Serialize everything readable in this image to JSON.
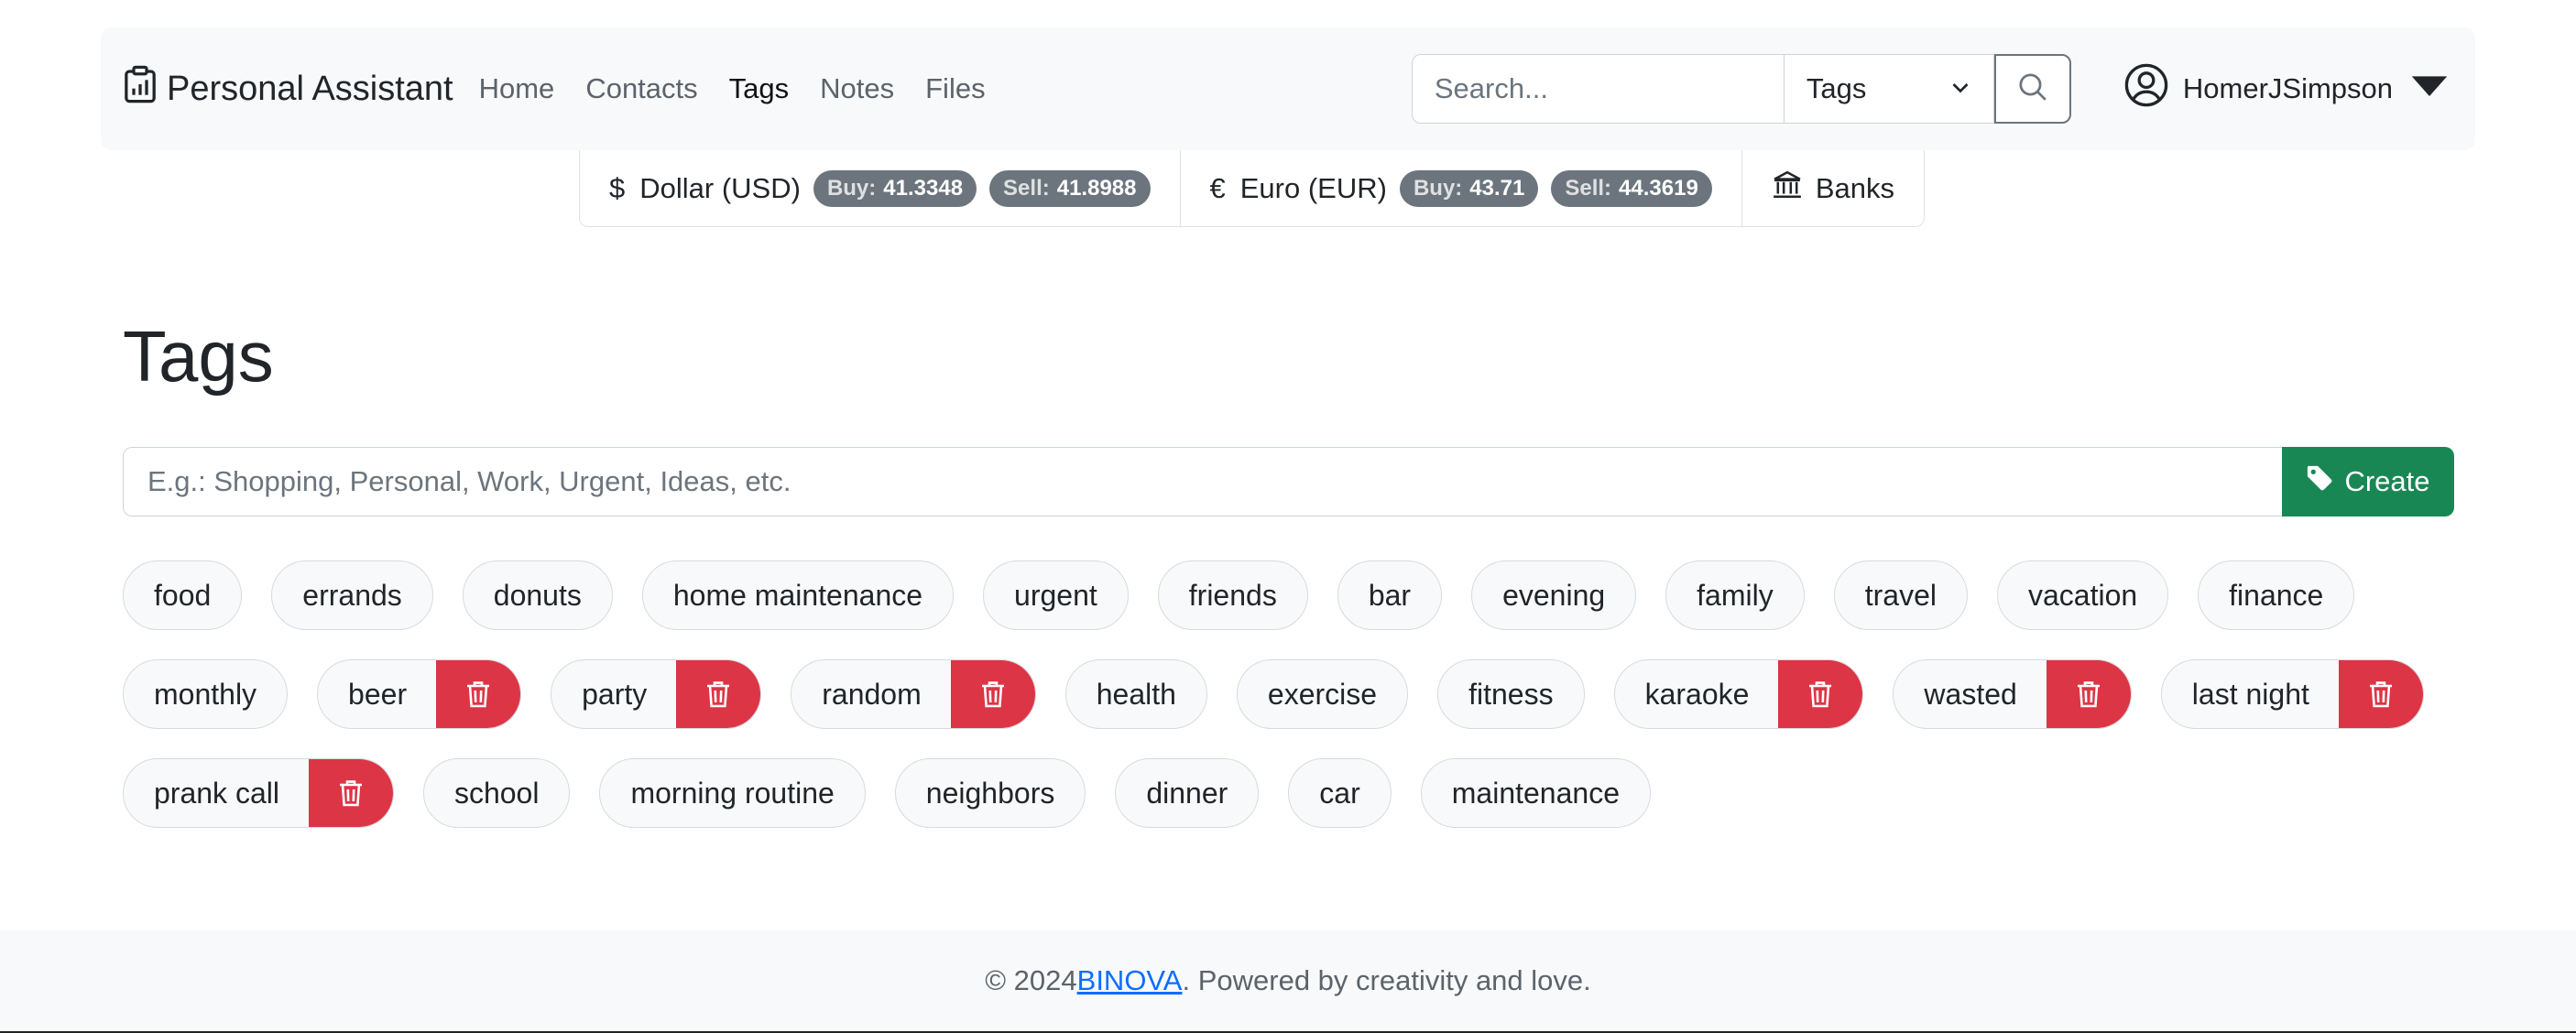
{
  "brand": {
    "name": "Personal Assistant"
  },
  "nav": {
    "links": [
      {
        "label": "Home",
        "active": false
      },
      {
        "label": "Contacts",
        "active": false
      },
      {
        "label": "Tags",
        "active": true
      },
      {
        "label": "Notes",
        "active": false
      },
      {
        "label": "Files",
        "active": false
      }
    ]
  },
  "search": {
    "placeholder": "Search...",
    "scope": "Tags"
  },
  "user": {
    "name": "HomerJSimpson"
  },
  "currency": {
    "usd": {
      "symbol": "$",
      "name": "Dollar (USD)",
      "buy_label": "Buy:",
      "buy": "41.3348",
      "sell_label": "Sell:",
      "sell": "41.8988"
    },
    "eur": {
      "symbol": "€",
      "name": "Euro (EUR)",
      "buy_label": "Buy:",
      "buy": "43.71",
      "sell_label": "Sell:",
      "sell": "44.3619"
    },
    "banks_label": "Banks"
  },
  "page": {
    "title": "Tags",
    "input_placeholder": "E.g.: Shopping, Personal, Work, Urgent, Ideas, etc.",
    "create_label": "Create"
  },
  "tags": [
    {
      "label": "food",
      "deletable": false
    },
    {
      "label": "errands",
      "deletable": false
    },
    {
      "label": "donuts",
      "deletable": false
    },
    {
      "label": "home maintenance",
      "deletable": false
    },
    {
      "label": "urgent",
      "deletable": false
    },
    {
      "label": "friends",
      "deletable": false
    },
    {
      "label": "bar",
      "deletable": false
    },
    {
      "label": "evening",
      "deletable": false
    },
    {
      "label": "family",
      "deletable": false
    },
    {
      "label": "travel",
      "deletable": false
    },
    {
      "label": "vacation",
      "deletable": false
    },
    {
      "label": "finance",
      "deletable": false
    },
    {
      "label": "monthly",
      "deletable": false
    },
    {
      "label": "beer",
      "deletable": true
    },
    {
      "label": "party",
      "deletable": true
    },
    {
      "label": "random",
      "deletable": true
    },
    {
      "label": "health",
      "deletable": false
    },
    {
      "label": "exercise",
      "deletable": false
    },
    {
      "label": "fitness",
      "deletable": false
    },
    {
      "label": "karaoke",
      "deletable": true
    },
    {
      "label": "wasted",
      "deletable": true
    },
    {
      "label": "last night",
      "deletable": true
    },
    {
      "label": "prank call",
      "deletable": true
    },
    {
      "label": "school",
      "deletable": false
    },
    {
      "label": "morning routine",
      "deletable": false
    },
    {
      "label": "neighbors",
      "deletable": false
    },
    {
      "label": "dinner",
      "deletable": false
    },
    {
      "label": "car",
      "deletable": false
    },
    {
      "label": "maintenance",
      "deletable": false
    }
  ],
  "footer": {
    "prefix": "© 2024 ",
    "link": "BINOVA",
    "suffix": ". Powered by creativity and love."
  },
  "colors": {
    "danger": "#dc3545",
    "success": "#198754",
    "secondary": "#6c757d",
    "link": "#0d6efd"
  }
}
